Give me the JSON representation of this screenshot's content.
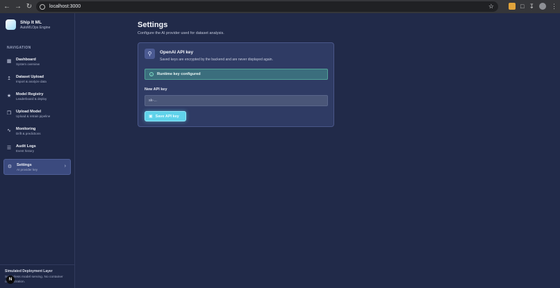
{
  "browser": {
    "url": "localhost:3000"
  },
  "brand": {
    "name": "Ship It ML",
    "subtitle": "AutoMLOps Engine"
  },
  "nav": {
    "section_label": "NAVIGATION",
    "items": [
      {
        "title": "Dashboard",
        "subtitle": "System overview"
      },
      {
        "title": "Dataset Upload",
        "subtitle": "Import & analyze data"
      },
      {
        "title": "Model Registry",
        "subtitle": "Leaderboard & deploy"
      },
      {
        "title": "Upload Model",
        "subtitle": "Upload & retrain pipeline"
      },
      {
        "title": "Monitoring",
        "subtitle": "Drift & predictions"
      },
      {
        "title": "Audit Logs",
        "subtitle": "Event history"
      },
      {
        "title": "Settings",
        "subtitle": "AI provider key"
      }
    ]
  },
  "footer": {
    "title": "Simulated Deployment Layer",
    "description": "Serverless model serving. No container orchestration."
  },
  "page": {
    "title": "Settings",
    "subtitle": "Configure the AI provider used for dataset analysis."
  },
  "card": {
    "title": "OpenAI API key",
    "description": "Saved keys are encrypted by the backend and are never displayed again.",
    "status": "Runtime key configured",
    "field_label": "New API key",
    "input_value": "",
    "input_placeholder": "sk-...",
    "save_label": "Save API key"
  },
  "colors": {
    "background": "#212a49",
    "card": "#2f3b64",
    "accent": "#5fd2ea",
    "status_ok": "#3b6e7d"
  }
}
